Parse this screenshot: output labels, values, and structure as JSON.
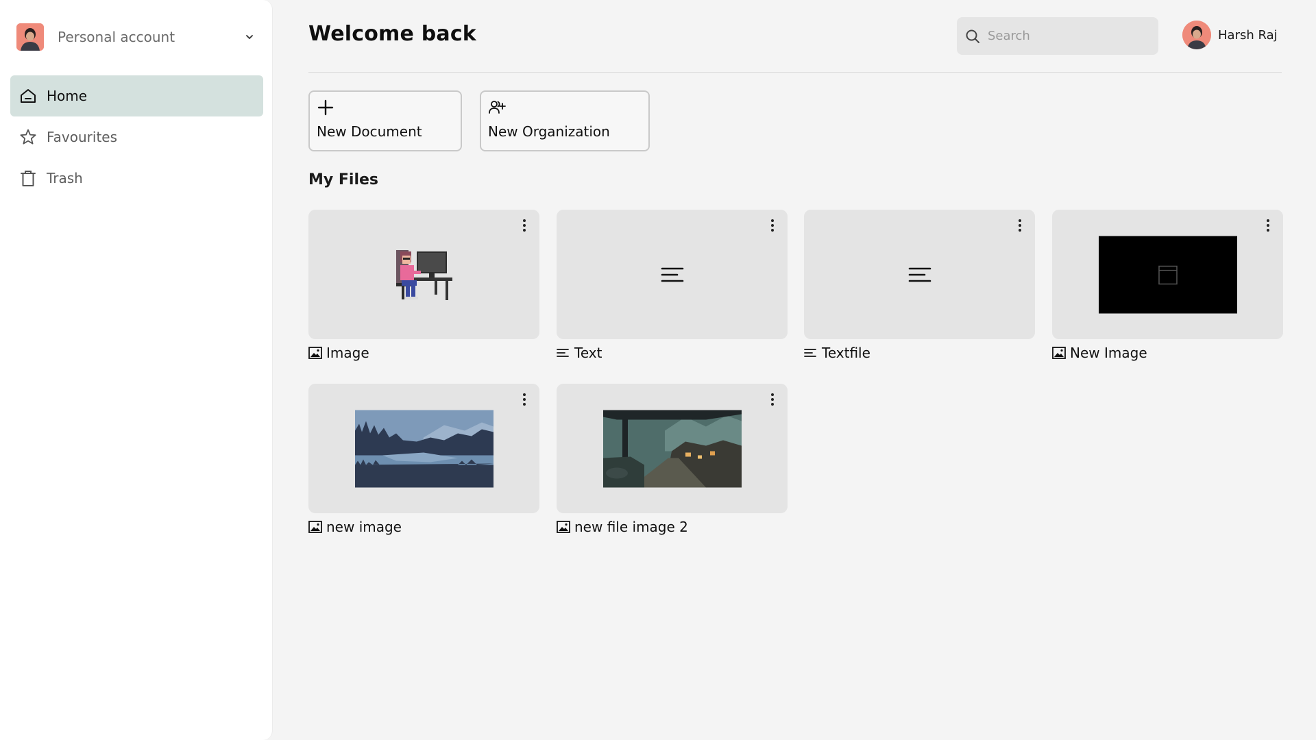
{
  "sidebar": {
    "account_label": "Personal account",
    "items": [
      {
        "label": "Home",
        "icon": "home-icon",
        "active": true
      },
      {
        "label": "Favourites",
        "icon": "star-icon",
        "active": false
      },
      {
        "label": "Trash",
        "icon": "trash-icon",
        "active": false
      }
    ]
  },
  "header": {
    "title": "Welcome back",
    "search_placeholder": "Search",
    "user_name": "Harsh Raj"
  },
  "actions": {
    "new_document": "New Document",
    "new_organization": "New Organization"
  },
  "files": {
    "section_title": "My Files",
    "items": [
      {
        "name": "Image",
        "type": "image",
        "icon": "image-icon",
        "thumbnail": "pixel-art-desk-illustration"
      },
      {
        "name": "Text",
        "type": "text",
        "icon": "text-lines-icon",
        "thumbnail": "text-lines-icon"
      },
      {
        "name": "Textfile",
        "type": "text",
        "icon": "text-lines-icon",
        "thumbnail": "text-lines-icon"
      },
      {
        "name": "New Image",
        "type": "image",
        "icon": "image-icon",
        "thumbnail": "black-screenshot"
      },
      {
        "name": "new image",
        "type": "image",
        "icon": "image-icon",
        "thumbnail": "lake-forest-landscape"
      },
      {
        "name": "new file image 2",
        "type": "image",
        "icon": "image-icon",
        "thumbnail": "rainy-street-scene"
      }
    ]
  },
  "colors": {
    "background": "#f4f4f4",
    "sidebar": "#ffffff",
    "active_nav": "#d4e1de",
    "card": "#e4e4e4",
    "avatar": "#ef8a7a"
  }
}
